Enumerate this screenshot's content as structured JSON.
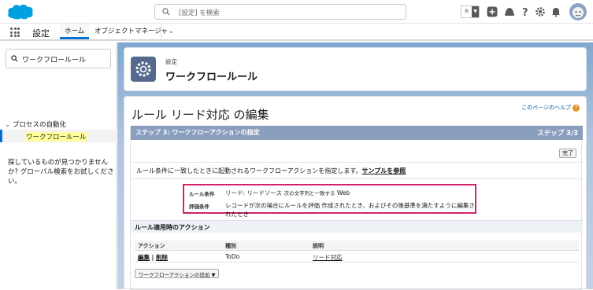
{
  "header": {
    "search_placeholder": "[設定] を検索",
    "brand_color": "#00a1e0"
  },
  "nav": {
    "app_name": "設定",
    "tabs": [
      {
        "label": "ホーム"
      },
      {
        "label": "オブジェクトマネージャ"
      }
    ]
  },
  "sidebar": {
    "quick_find_value": "ワークフロールール",
    "parent_label": "プロセスの自動化",
    "child_label": "ワークフロールール",
    "not_found_text": "探しているものが見つかりませんか? グローバル検索をお試しください。"
  },
  "page_header": {
    "kicker": "設定",
    "title": "ワークフロールール"
  },
  "editor": {
    "title": "ルール リード対応 の編集",
    "help_link": "このページのヘルプ",
    "step_label": "ステップ 3: ワークフローアクションの指定",
    "step_count": "ステップ 3/3",
    "done_button": "完了",
    "description": "ルール条件に一致したときに起動されるワークフローアクションを指定します。",
    "sample_link": "サンプルを参照",
    "criteria": {
      "rule_label": "ルール条件",
      "rule_value_main": "リード: リードソース",
      "rule_value_small": "次の文字列と一致する",
      "rule_value_end": "Web",
      "eval_label": "評価条件",
      "eval_value": "レコードが次の場合にルールを評価 作成されたとき、およびその後基準を満たすように編集されたとき"
    },
    "section_title": "ルール適用時のアクション",
    "table": {
      "headers": [
        "アクション",
        "種別",
        "説明"
      ],
      "row": {
        "edit": "編集",
        "separator": "|",
        "delete": "削除",
        "type": "ToDo",
        "description": "リード対応"
      }
    },
    "add_button": "ワークフローアクションの追加 ▼"
  }
}
